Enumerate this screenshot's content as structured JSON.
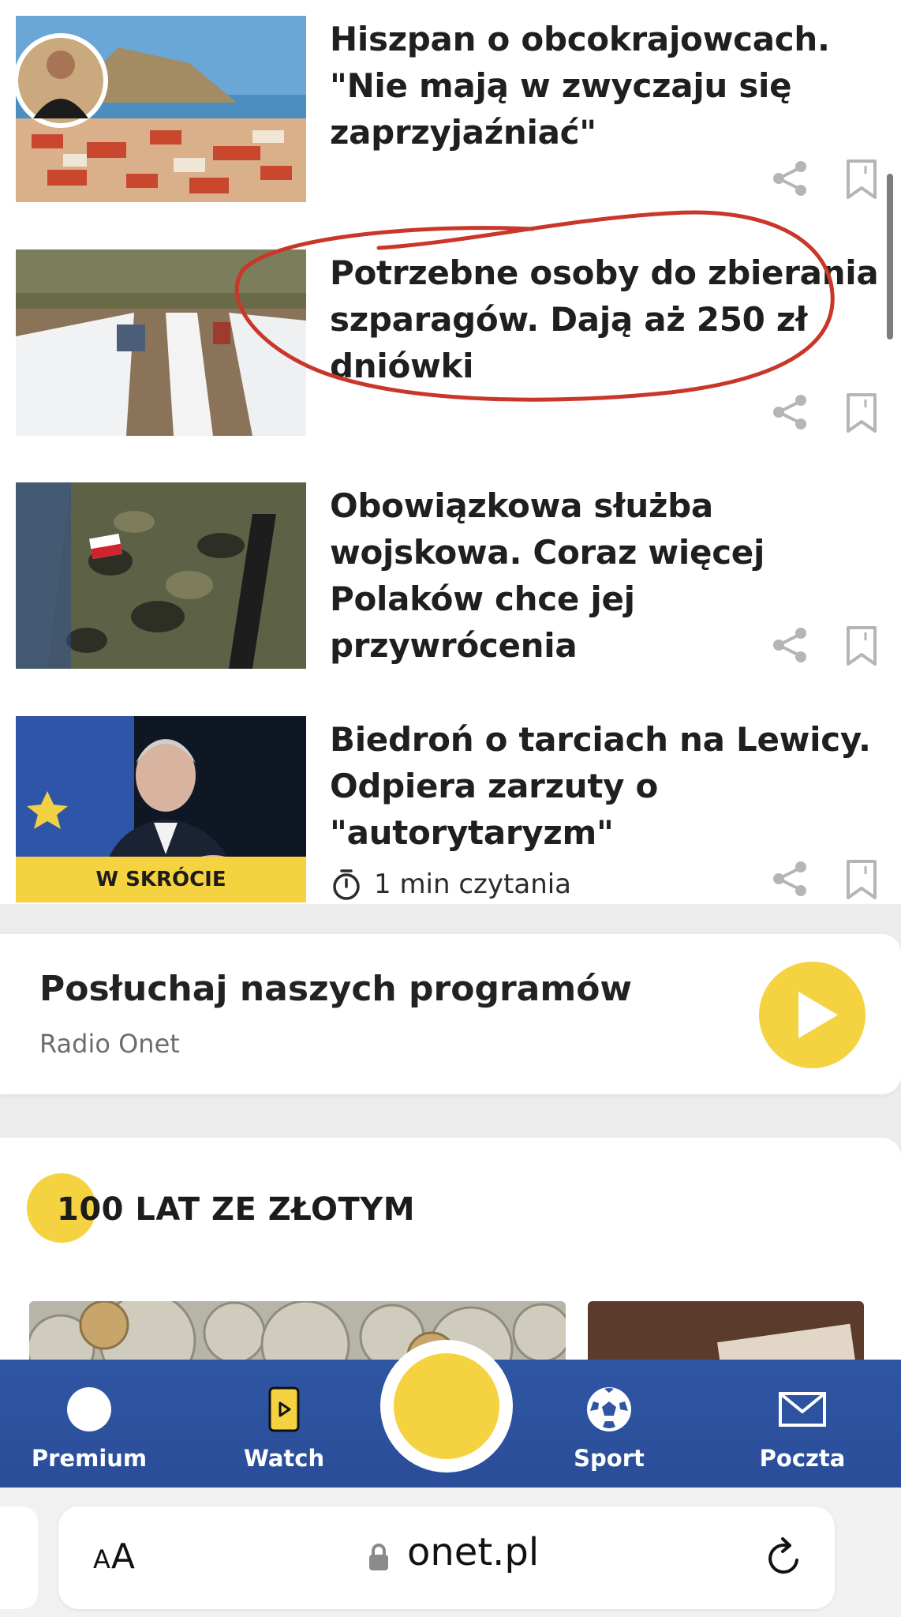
{
  "articles": [
    {
      "title": "Hiszpan o obcokrajowcach. \"Nie mają w zwyczaju się zaprzyjaźniać\""
    },
    {
      "title": "Potrzebne osoby do zbierania szparagów. Dają aż 250 zł dniówki"
    },
    {
      "title": "Obowiązkowa służba wojskowa. Coraz więcej Polaków chce jej przywrócenia"
    },
    {
      "title": "Biedroń o tarciach na Lewicy. Odpiera zarzuty o \"autorytaryzm\"",
      "badge": "W SKRÓCIE",
      "read_time": "1 min czytania"
    }
  ],
  "radio": {
    "title": "Posłuchaj naszych programów",
    "subtitle": "Radio Onet"
  },
  "section": {
    "title": "100 LAT ZE ZŁOTYM"
  },
  "bottom_nav": {
    "items": [
      {
        "label": "Premium",
        "icon": "circle-icon"
      },
      {
        "label": "Watch",
        "icon": "play-icon"
      },
      {
        "label": "Sport",
        "icon": "soccer-ball-icon"
      },
      {
        "label": "Poczta",
        "icon": "mail-icon"
      }
    ]
  },
  "browser": {
    "aa_big": "A",
    "aa_small": "A",
    "url": "onet.pl"
  },
  "colors": {
    "accent_yellow": "#f5d23f",
    "nav_blue": "#2f56a3",
    "annotation_red": "#c8372a"
  }
}
